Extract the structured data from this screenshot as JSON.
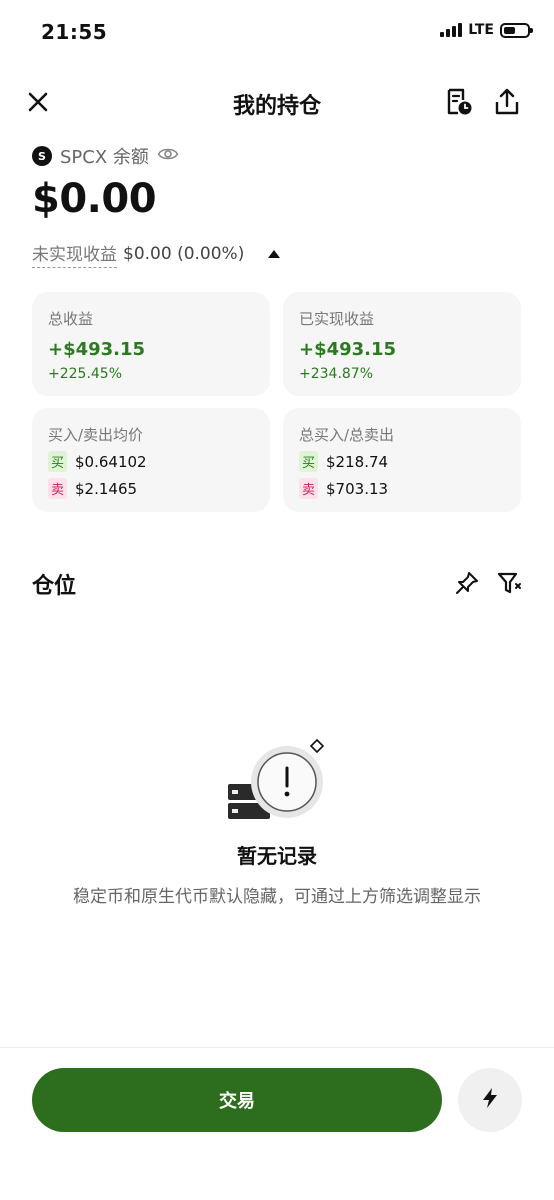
{
  "status_bar": {
    "time": "21:55",
    "network": "LTE",
    "signal_bars": 4,
    "battery_level": 0.5
  },
  "header": {
    "title": "我的持仓",
    "icons": [
      "close-icon",
      "history-icon",
      "share-icon"
    ]
  },
  "asset": {
    "coin_logo_letter": "S",
    "label": "SPCX 余额",
    "balance": "$0.00",
    "unrealized_label": "未实现收益",
    "unrealized_value": "$0.00 (0.00%)"
  },
  "stats": {
    "total_pnl": {
      "label": "总收益",
      "value": "+$493.15",
      "percent": "+225.45%"
    },
    "realized_pnl": {
      "label": "已实现收益",
      "value": "+$493.15",
      "percent": "+234.87%"
    },
    "avg_price": {
      "label": "买入/卖出均价",
      "buy_tag": "买",
      "buy_value": "$0.64102",
      "sell_tag": "卖",
      "sell_value": "$2.1465"
    },
    "totals": {
      "label": "总买入/总卖出",
      "buy_tag": "买",
      "buy_value": "$218.74",
      "sell_tag": "卖",
      "sell_value": "$703.13"
    }
  },
  "positions": {
    "title": "仓位",
    "empty_title": "暂无记录",
    "empty_desc": "稳定币和原生代币默认隐藏，可通过上方筛选调整显示"
  },
  "footer": {
    "trade_label": "交易"
  },
  "colors": {
    "positive": "#2b7a1f",
    "primary_button": "#2d6e1e",
    "sell": "#c22355"
  }
}
